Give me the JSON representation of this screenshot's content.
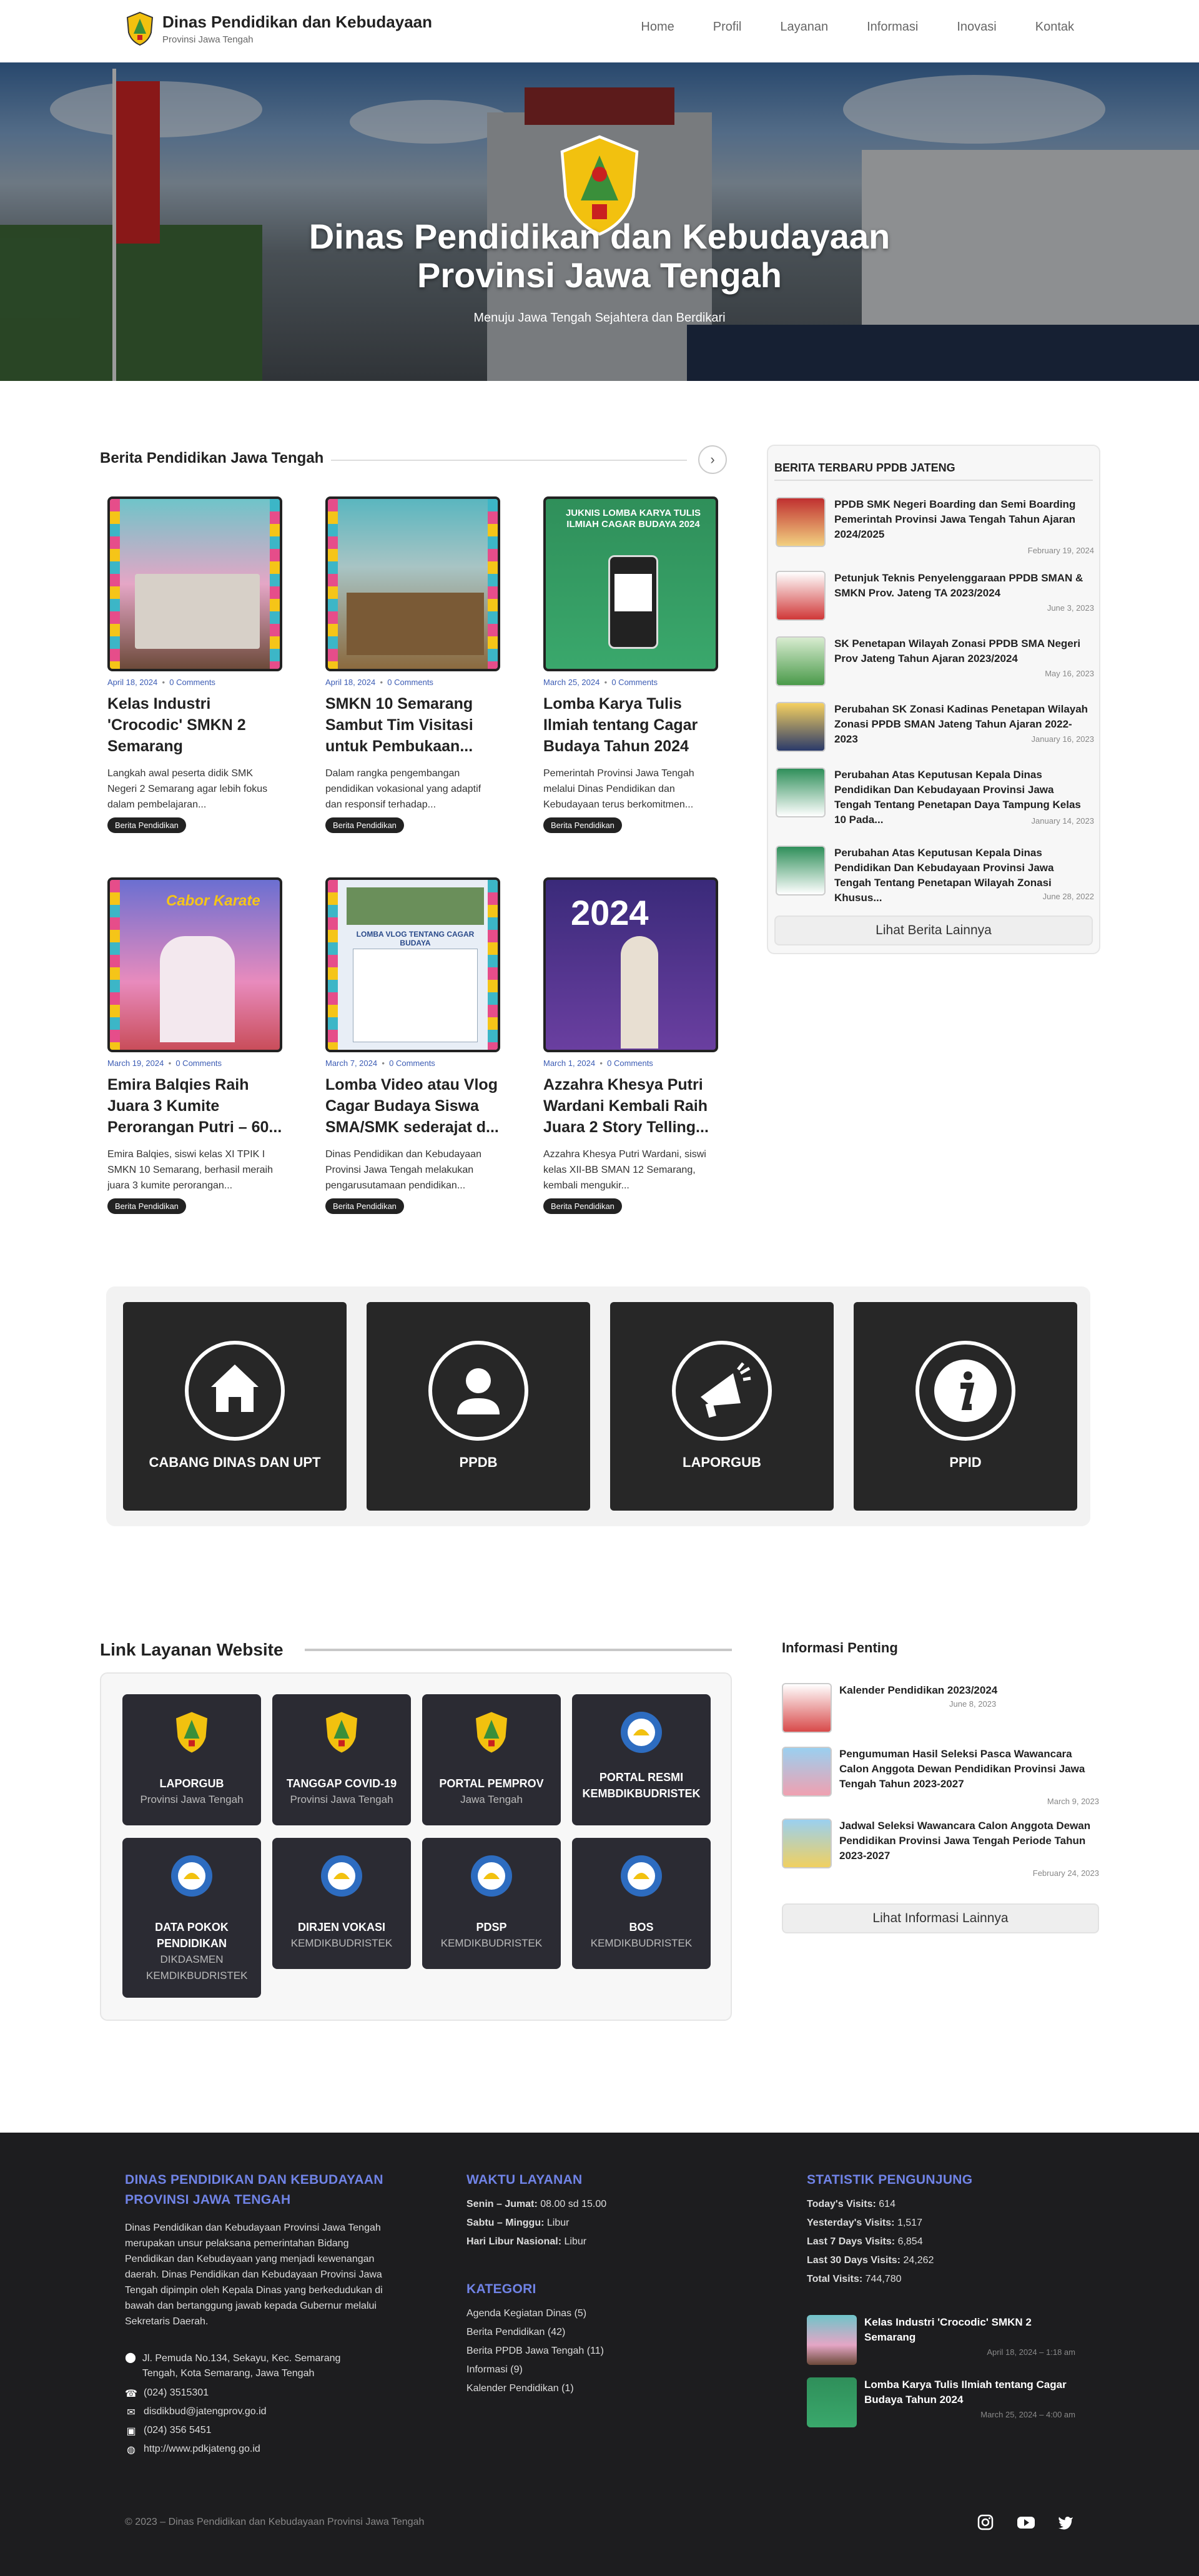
{
  "header": {
    "title": "Dinas Pendidikan dan Kebudayaan",
    "subtitle": "Provinsi Jawa Tengah",
    "nav": [
      "Home",
      "Profil",
      "Layanan",
      "Informasi",
      "Inovasi",
      "Kontak"
    ]
  },
  "hero": {
    "title_line1": "Dinas Pendidikan dan Kebudayaan",
    "title_line2": "Provinsi Jawa Tengah",
    "tagline": "Menuju Jawa Tengah Sejahtera dan Berdikari"
  },
  "news": {
    "section_title": "Berita Pendidikan Jawa Tengah",
    "next_icon": "chevron-right-icon",
    "cards": [
      {
        "date": "April 18, 2024",
        "comments": "0 Comments",
        "title": "Kelas Industri 'Crocodic' SMKN 2 Semarang",
        "excerpt": "Langkah awal peserta didik SMK Negeri 2 Semarang agar lebih fokus dalam pembelajaran...",
        "tag": "Berita Pendidikan"
      },
      {
        "date": "April 18, 2024",
        "comments": "0 Comments",
        "title": "SMKN 10 Semarang Sambut Tim Visitasi untuk Pembukaan...",
        "excerpt": "Dalam rangka pengembangan pendidikan vokasional yang adaptif dan responsif terhadap...",
        "tag": "Berita Pendidikan"
      },
      {
        "date": "March 25, 2024",
        "comments": "0 Comments",
        "title": "Lomba Karya Tulis Ilmiah tentang Cagar Budaya Tahun 2024",
        "excerpt": "Pemerintah Provinsi Jawa Tengah melalui Dinas Pendidikan dan Kebudayaan terus berkomitmen...",
        "tag": "Berita Pendidikan",
        "img_text": "JUKNIS LOMBA KARYA TULIS ILMIAH CAGAR BUDAYA 2024"
      },
      {
        "date": "March 19, 2024",
        "comments": "0 Comments",
        "title": "Emira Balqies Raih Juara 3 Kumite Perorangan Putri – 60...",
        "excerpt": "Emira Balqies, siswi kelas XI TPIK I SMKN 10 Semarang, berhasil meraih juara 3 kumite perorangan...",
        "tag": "Berita Pendidikan",
        "img_text": "Cabor Karate"
      },
      {
        "date": "March 7, 2024",
        "comments": "0 Comments",
        "title": "Lomba Video atau Vlog Cagar Budaya Siswa SMA/SMK sederajat d...",
        "excerpt": "Dinas Pendidikan dan Kebudayaan Provinsi Jawa Tengah melakukan pengarusutamaan pendidikan...",
        "tag": "Berita Pendidikan",
        "img_text": "LOMBA VLOG TENTANG CAGAR BUDAYA"
      },
      {
        "date": "March 1, 2024",
        "comments": "0 Comments",
        "title": "Azzahra Khesya Putri Wardani Kembali Raih Juara 2 Story Telling...",
        "excerpt": "Azzahra Khesya Putri Wardani, siswi kelas XII-BB SMAN 12 Semarang, kembali mengukir...",
        "tag": "Berita Pendidikan",
        "img_text": "2024"
      }
    ]
  },
  "ppdb": {
    "title": "BERITA TERBARU PPDB JATENG",
    "items": [
      {
        "title": "PPDB SMK Negeri Boarding dan Semi Boarding Pemerintah Provinsi Jawa Tengah Tahun Ajaran 2024/2025",
        "date": "February 19, 2024"
      },
      {
        "title": "Petunjuk Teknis Penyelenggaraan PPDB SMAN & SMKN Prov. Jateng TA 2023/2024",
        "date": "June 3, 2023"
      },
      {
        "title": "SK Penetapan Wilayah Zonasi PPDB SMA Negeri Prov Jateng Tahun Ajaran 2023/2024",
        "date": "May 16, 2023"
      },
      {
        "title": "Perubahan SK Zonasi Kadinas Penetapan Wilayah Zonasi PPDB SMAN Jateng Tahun Ajaran 2022-2023",
        "date": "January 16, 2023"
      },
      {
        "title": "Perubahan Atas Keputusan Kepala Dinas Pendidikan Dan Kebudayaan Provinsi Jawa Tengah Tentang Penetapan Daya Tampung Kelas 10 Pada...",
        "date": "January 14, 2023"
      },
      {
        "title": "Perubahan Atas Keputusan Kepala Dinas Pendidikan Dan Kebudayaan Provinsi Jawa Tengah Tentang Penetapan Wilayah Zonasi Khusus...",
        "date": "June 28, 2022"
      }
    ],
    "more_label": "Lihat Berita Lainnya"
  },
  "quick_links": [
    {
      "label": "CABANG DINAS DAN UPT",
      "icon": "home-icon"
    },
    {
      "label": "PPDB",
      "icon": "user-icon"
    },
    {
      "label": "LAPORGUB",
      "icon": "megaphone-icon"
    },
    {
      "label": "PPID",
      "icon": "info-icon"
    }
  ],
  "link_layanan": {
    "title": "Link Layanan Website",
    "tiles": [
      {
        "title": "LAPORGUB",
        "sub": "Provinsi Jawa Tengah",
        "icon": "jateng-crest-icon"
      },
      {
        "title": "TANGGAP COVID-19",
        "sub": "Provinsi Jawa Tengah",
        "icon": "jateng-crest-icon"
      },
      {
        "title": "PORTAL PEMPROV",
        "sub": "Jawa Tengah",
        "icon": "jateng-crest-icon"
      },
      {
        "title": "PORTAL RESMI KEMBDIKBUDRISTEK",
        "sub": "",
        "icon": "tut-wuri-icon"
      },
      {
        "title": "DATA POKOK PENDIDIKAN",
        "sub": "DIKDASMEN KEMDIKBUDRISTEK",
        "icon": "tut-wuri-icon"
      },
      {
        "title": "DIRJEN VOKASI",
        "sub": "KEMDIKBUDRISTEK",
        "icon": "tut-wuri-icon"
      },
      {
        "title": "PDSP",
        "sub": "KEMDIKBUDRISTEK",
        "icon": "tut-wuri-icon"
      },
      {
        "title": "BOS",
        "sub": "KEMDIKBUDRISTEK",
        "icon": "tut-wuri-icon"
      }
    ]
  },
  "informasi": {
    "title": "Informasi Penting",
    "items": [
      {
        "title": "Kalender Pendidikan 2023/2024",
        "date": "June 8, 2023"
      },
      {
        "title": "Pengumuman Hasil Seleksi Pasca Wawancara Calon Anggota Dewan Pendidikan Provinsi Jawa Tengah Tahun 2023-2027",
        "date": "March 9, 2023"
      },
      {
        "title": "Jadwal Seleksi Wawancara Calon Anggota Dewan Pendidikan Provinsi Jawa Tengah Periode Tahun 2023-2027",
        "date": "February 24, 2023"
      }
    ],
    "more_label": "Lihat Informasi Lainnya"
  },
  "footer": {
    "org_title": "DINAS PENDIDIKAN DAN KEBUDAYAAN PROVINSI JAWA TENGAH",
    "org_desc": "Dinas Pendidikan dan Kebudayaan Provinsi Jawa Tengah merupakan unsur pelaksana pemerintahan Bidang Pendidikan dan Kebudayaan yang menjadi kewenangan daerah. Dinas Pendidikan dan Kebudayaan Provinsi Jawa Tengah dipimpin oleh Kepala Dinas yang berkedudukan di bawah dan bertanggung jawab kepada Gubernur melalui Sekretaris Daerah.",
    "address": "Jl. Pemuda No.134, Sekayu, Kec. Semarang Tengah, Kota Semarang, Jawa Tengah",
    "phone": "(024) 3515301",
    "email": "disdikbud@jatengprov.go.id",
    "fax": "(024) 356 5451",
    "website": "http://www.pdkjateng.go.id",
    "hours_title": "WAKTU LAYANAN",
    "hours": [
      {
        "day": "Senin – Jumat:",
        "time": "08.00 sd 15.00"
      },
      {
        "day": "Sabtu – Minggu:",
        "time": "Libur"
      },
      {
        "day": "Hari Libur Nasional:",
        "time": "Libur"
      }
    ],
    "cat_title": "KATEGORI",
    "categories": [
      "Agenda Kegiatan Dinas (5)",
      "Berita Pendidikan (42)",
      "Berita PPDB Jawa Tengah (11)",
      "Informasi (9)",
      "Kalender Pendidikan (1)"
    ],
    "stats_title": "STATISTIK PENGUNJUNG",
    "stats": [
      {
        "label": "Today's Visits:",
        "value": "614"
      },
      {
        "label": "Yesterday's Visits:",
        "value": "1,517"
      },
      {
        "label": "Last 7 Days Visits:",
        "value": "6,854"
      },
      {
        "label": "Last 30 Days Visits:",
        "value": "24,262"
      },
      {
        "label": "Total Visits:",
        "value": "744,780"
      }
    ],
    "recent": [
      {
        "title": "Kelas Industri 'Crocodic' SMKN 2 Semarang",
        "date": "April 18, 2024 – 1:18 am"
      },
      {
        "title": "Lomba Karya Tulis Ilmiah tentang Cagar Budaya Tahun 2024",
        "date": "March 25, 2024 – 4:00 am"
      }
    ],
    "copyright": "© 2023 – Dinas Pendidikan dan Kebudayaan Provinsi Jawa Tengah",
    "social_icons": [
      "instagram-icon",
      "youtube-icon",
      "twitter-icon"
    ]
  }
}
